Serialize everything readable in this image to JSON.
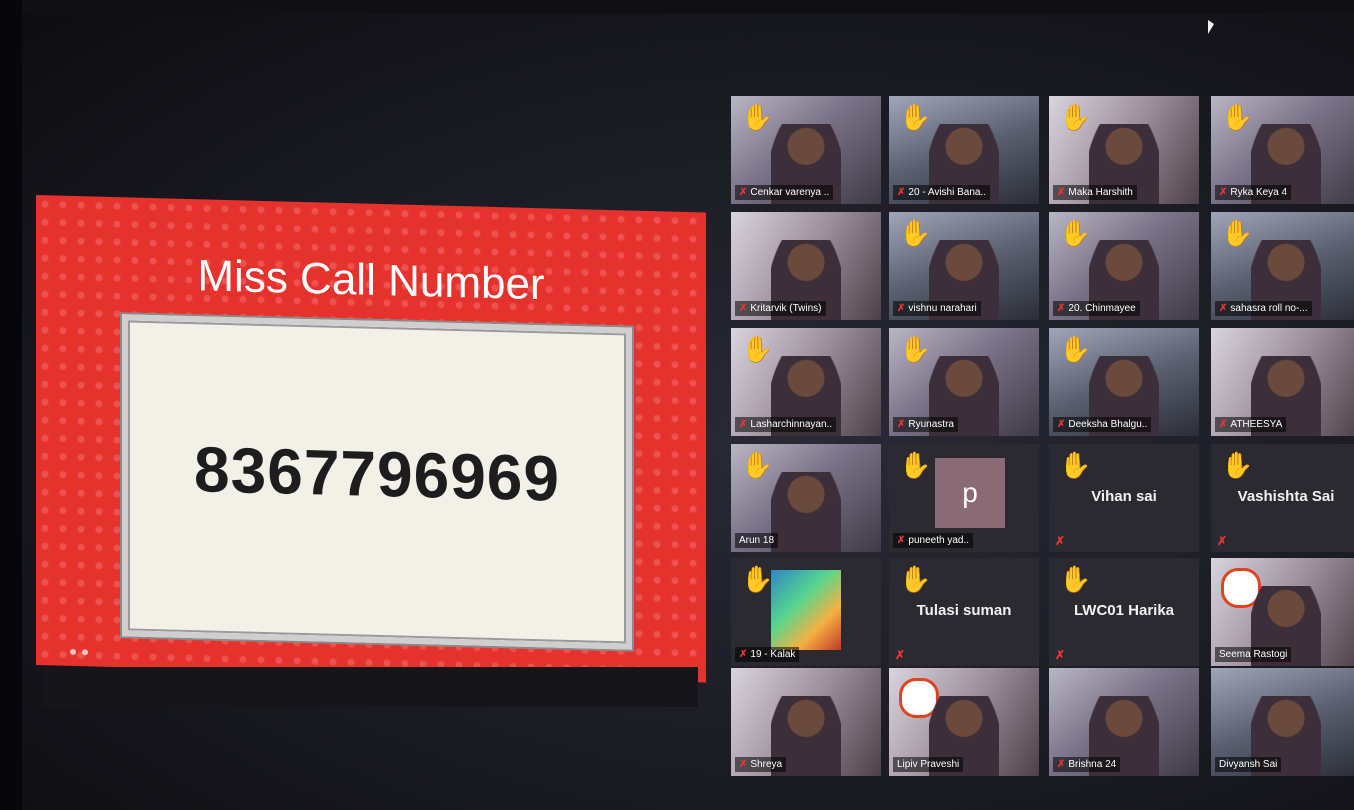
{
  "slide": {
    "title": "Miss Call Number",
    "number": "8367796969"
  },
  "participants": [
    {
      "name": "Cenkar varenya ..",
      "hand": true,
      "muted": true,
      "style": "cam-a"
    },
    {
      "name": "20 - Avishi Bana..",
      "hand": true,
      "muted": true,
      "style": "cam-b"
    },
    {
      "name": "Maka Harshith",
      "hand": true,
      "muted": true,
      "style": "cam-c"
    },
    {
      "name": "Ryka Keya 4",
      "hand": true,
      "muted": true,
      "style": "cam-a"
    },
    {
      "name": "Kritarvik (Twins)",
      "hand": false,
      "muted": true,
      "style": "cam-c"
    },
    {
      "name": "vishnu narahari",
      "hand": true,
      "muted": true,
      "style": "cam-b"
    },
    {
      "name": "20. Chinmayee",
      "hand": true,
      "muted": true,
      "style": "cam-a"
    },
    {
      "name": "sahasra roll no-...",
      "hand": true,
      "muted": true,
      "style": "cam-b"
    },
    {
      "name": "Lasharchinnayan..",
      "hand": true,
      "muted": true,
      "style": "cam-c"
    },
    {
      "name": "Ryunastra",
      "hand": true,
      "muted": true,
      "style": "cam-a"
    },
    {
      "name": "Deeksha Bhalgu..",
      "hand": true,
      "muted": true,
      "style": "cam-b"
    },
    {
      "name": "ATHEESYA",
      "hand": false,
      "muted": true,
      "style": "cam-c"
    },
    {
      "name": "Arun 18",
      "hand": true,
      "muted": false,
      "style": "cam-a"
    },
    {
      "name": "puneeth yad..",
      "hand": true,
      "muted": true,
      "style": "avatar",
      "initial": "p"
    },
    {
      "name": "Vihan sai",
      "hand": true,
      "muted": true,
      "style": "name-only"
    },
    {
      "name": "Vashishta Sai",
      "hand": true,
      "muted": true,
      "style": "name-only"
    },
    {
      "name": "19 - Kalak",
      "hand": true,
      "muted": true,
      "style": "art"
    },
    {
      "name": "Tulasi suman",
      "hand": true,
      "muted": true,
      "style": "name-only"
    },
    {
      "name": "LWC01 Harika",
      "hand": true,
      "muted": true,
      "style": "name-only"
    },
    {
      "name": "Seema Rastogi",
      "hand": false,
      "muted": false,
      "style": "logo"
    },
    {
      "name": "Shreya",
      "hand": false,
      "muted": true,
      "style": "cam-c"
    },
    {
      "name": "Lipiv Praveshi",
      "hand": false,
      "muted": false,
      "style": "logo"
    },
    {
      "name": "Brishna 24",
      "hand": false,
      "muted": true,
      "style": "cam-a"
    },
    {
      "name": "Divyansh Sai",
      "hand": false,
      "muted": false,
      "style": "cam-b"
    }
  ]
}
